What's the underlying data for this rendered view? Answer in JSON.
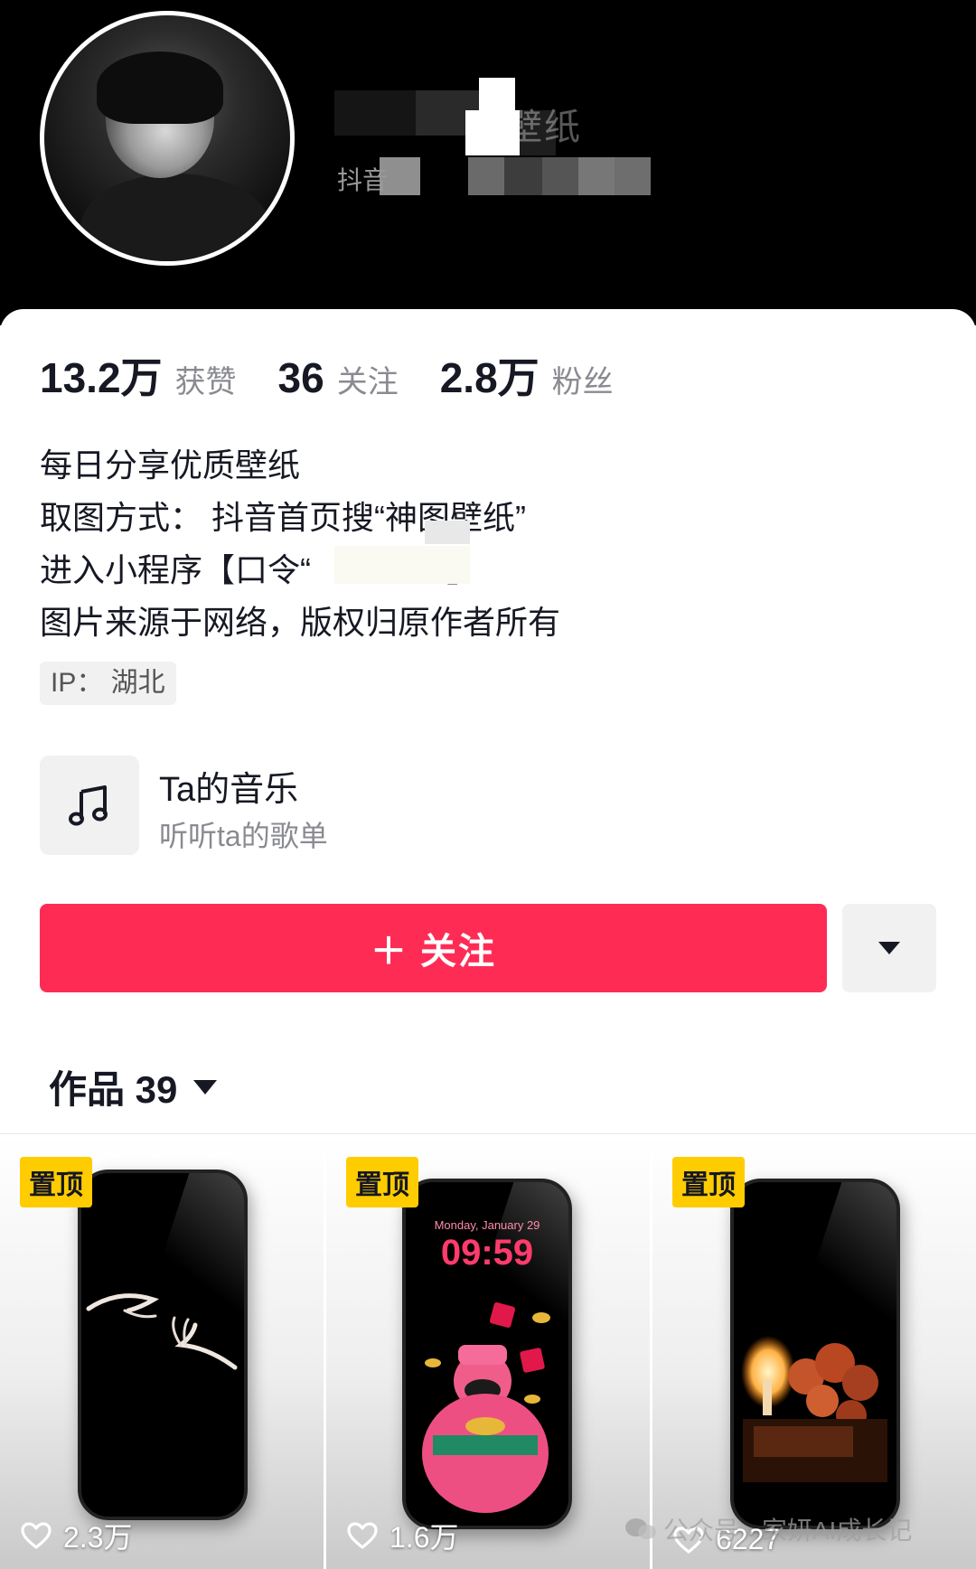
{
  "profile": {
    "name_fragment": "壁纸",
    "handle_prefix": "抖音"
  },
  "stats": [
    {
      "value": "13.2万",
      "label": "获赞"
    },
    {
      "value": "36",
      "label": "关注"
    },
    {
      "value": "2.8万",
      "label": "粉丝"
    }
  ],
  "bio": {
    "line1": "每日分享优质壁纸",
    "line2": "取图方式： 抖音首页搜“神图壁纸”",
    "line3": "进入小程序【口令“",
    "line3_end": "】",
    "line4": "图片来源于网络，版权归原作者所有"
  },
  "ip": "IP： 湖北",
  "music": {
    "icon": "music-note-icon",
    "title": "Ta的音乐",
    "subtitle": "听听ta的歌单"
  },
  "follow": {
    "label": "＋ 关注",
    "color": "#fe2c55"
  },
  "works": {
    "label": "作品 39"
  },
  "videos": [
    {
      "pin": "置顶",
      "likes": "2.3万",
      "theme": "hands"
    },
    {
      "pin": "置顶",
      "likes": "1.6万",
      "theme": "god-of-wealth",
      "clock_date": "Monday, January 29",
      "clock_time": "09:59"
    },
    {
      "pin": "置顶",
      "likes": "6227",
      "theme": "candle-roses"
    }
  ],
  "watermark": "公众号 · 家妍AI成长记",
  "colors": {
    "pin": "#ffcc00",
    "accent": "#fe2c55",
    "text": "#161823",
    "muted": "#8a8b91"
  }
}
